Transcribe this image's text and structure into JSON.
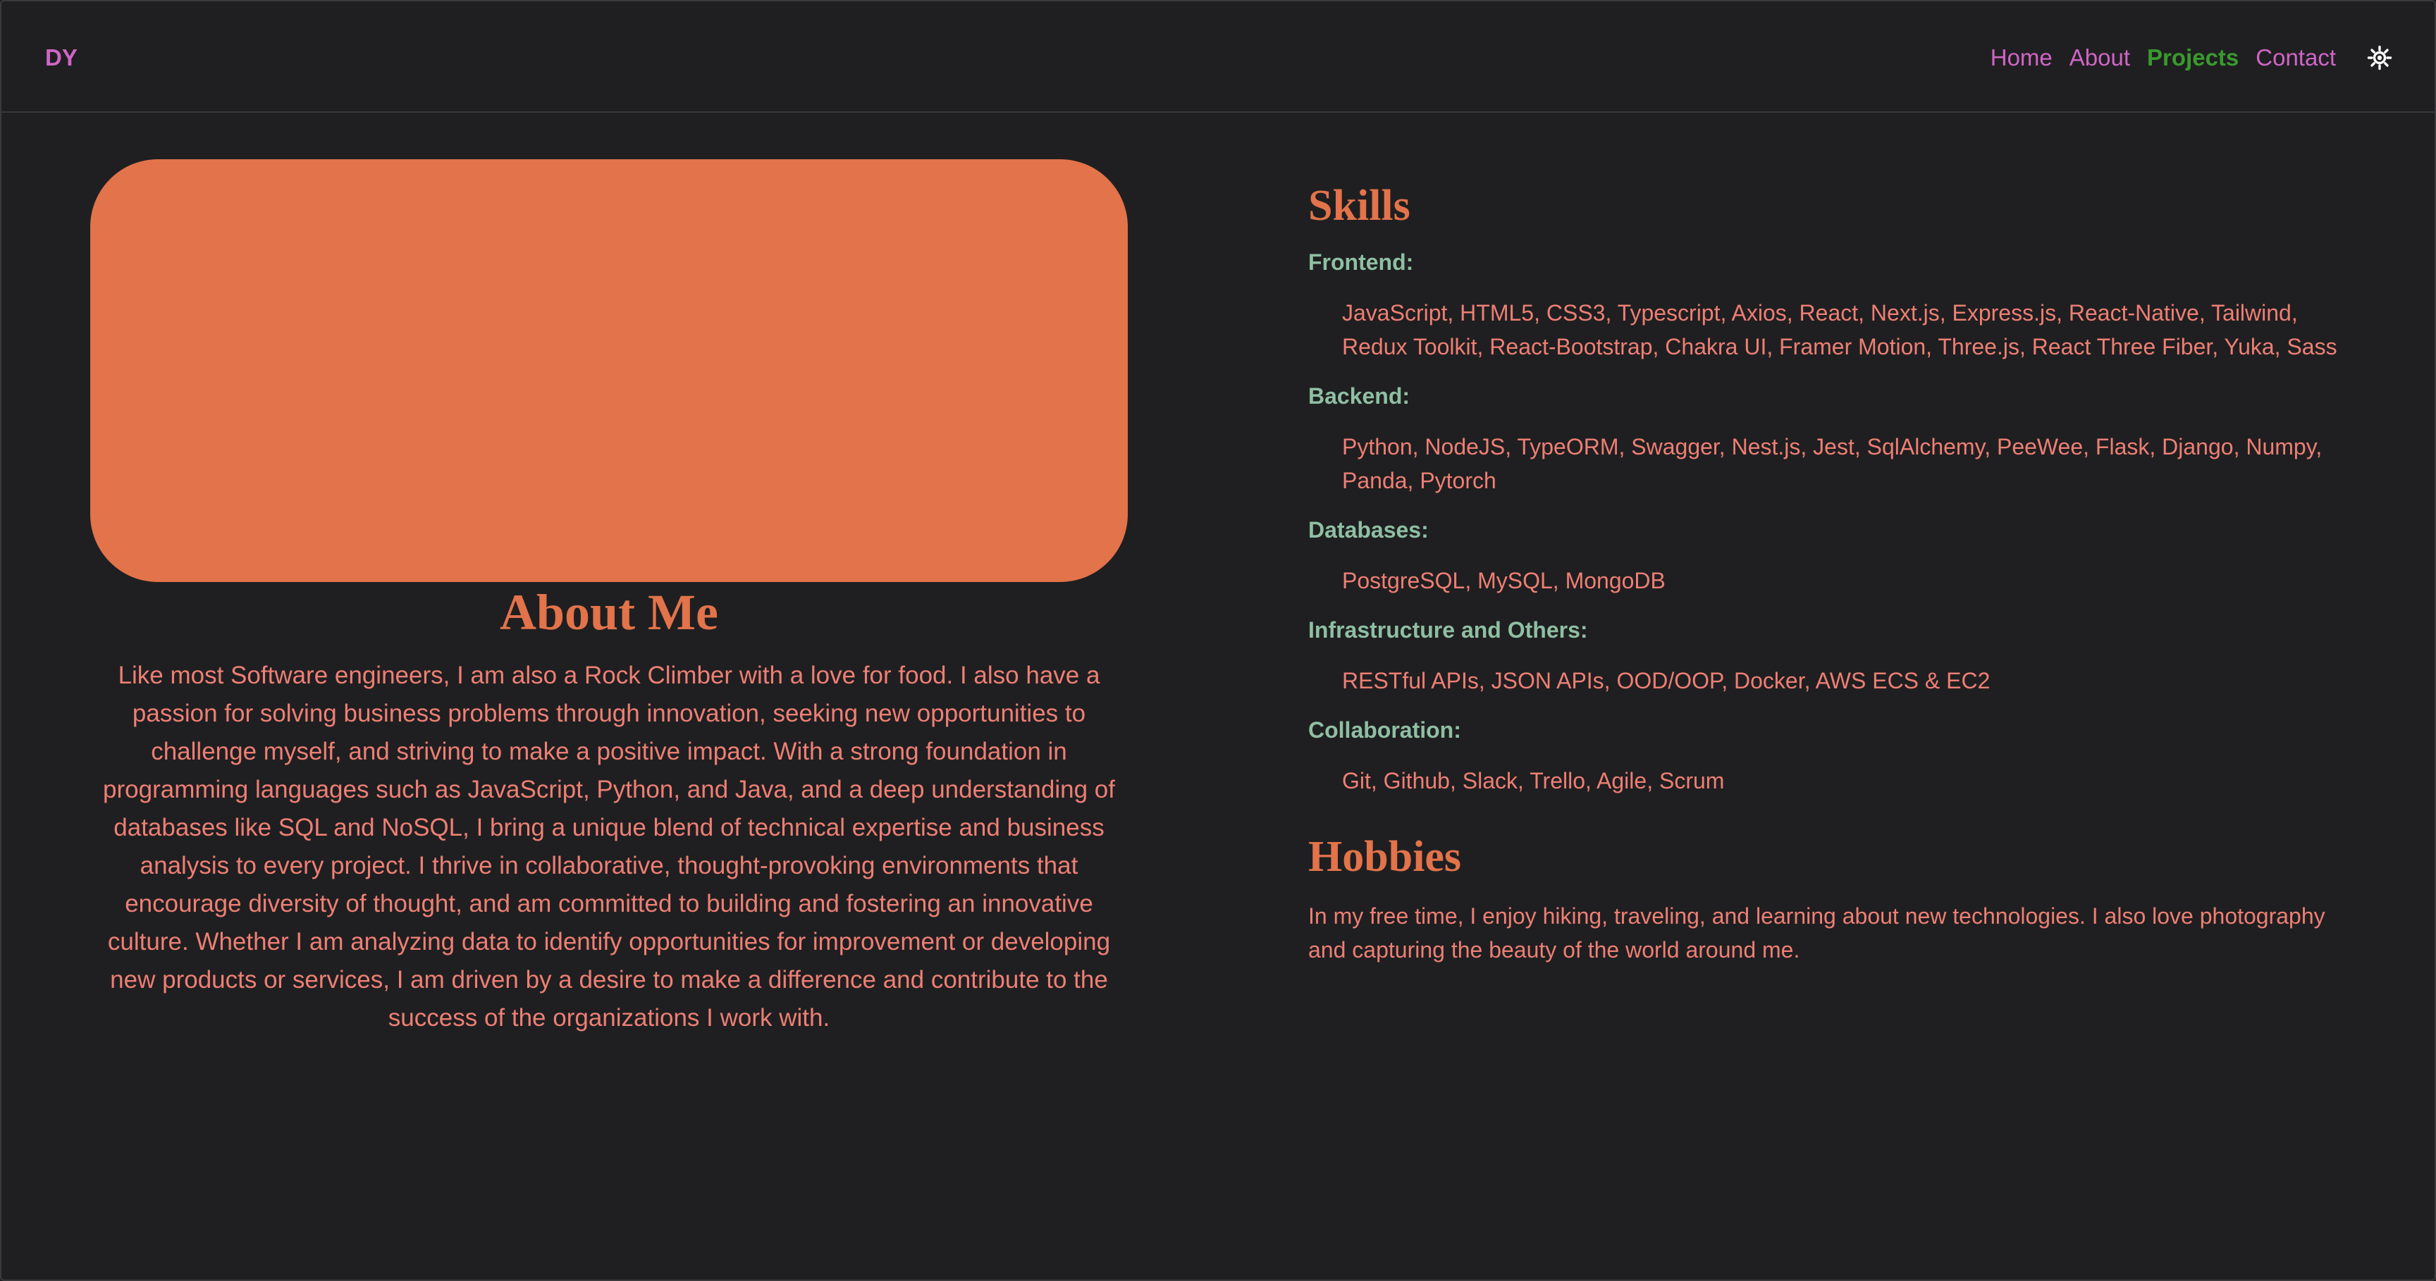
{
  "nav": {
    "logo": "DY",
    "links": [
      {
        "label": "Home"
      },
      {
        "label": "About"
      },
      {
        "label": "Projects"
      },
      {
        "label": "Contact"
      }
    ],
    "active_link": "Projects",
    "theme_toggle_icon": "sun-icon"
  },
  "about": {
    "title": "About Me",
    "text": "Like most Software engineers, I am also a Rock Climber with a love for food. I also have a passion for solving business problems through innovation, seeking new opportunities to challenge myself, and striving to make a positive impact. With a strong foundation in programming languages such as JavaScript, Python, and Java, and a deep understanding of databases like SQL and NoSQL, I bring a unique blend of technical expertise and business analysis to every project. I thrive in collaborative, thought-provoking environments that encourage diversity of thought, and am committed to building and fostering an innovative culture. Whether I am analyzing data to identify opportunities for improvement or developing new products or services, I am driven by a desire to make a difference and contribute to the success of the organizations I work with."
  },
  "skills": {
    "title": "Skills",
    "groups": [
      {
        "heading": "Frontend:",
        "items": "JavaScript, HTML5, CSS3, Typescript, Axios, React, Next.js, Express.js, React-Native, Tailwind, Redux Toolkit, React-Bootstrap, Chakra UI, Framer Motion, Three.js, React Three Fiber, Yuka, Sass"
      },
      {
        "heading": "Backend:",
        "items": "Python, NodeJS, TypeORM, Swagger, Nest.js, Jest, SqlAlchemy, PeeWee, Flask, Django, Numpy, Panda, Pytorch"
      },
      {
        "heading": "Databases:",
        "items": "PostgreSQL, MySQL, MongoDB"
      },
      {
        "heading": "Infrastructure and Others:",
        "items": "RESTful APIs, JSON APIs, OOD/OOP, Docker, AWS ECS & EC2"
      },
      {
        "heading": "Collaboration:",
        "items": "Git, Github, Slack, Trello, Agile, Scrum"
      }
    ]
  },
  "hobbies": {
    "title": "Hobbies",
    "text": "In my free time, I enjoy hiking, traveling, and learning about new technologies. I also love photography and capturing the beauty of the world around me."
  },
  "colors": {
    "background": "#1f1f21",
    "accent": "#e2734a",
    "text": "#ee7f74",
    "nav_link": "#d065c6",
    "nav_active": "#3a9a2e",
    "skill_heading": "#8fbfa3"
  }
}
